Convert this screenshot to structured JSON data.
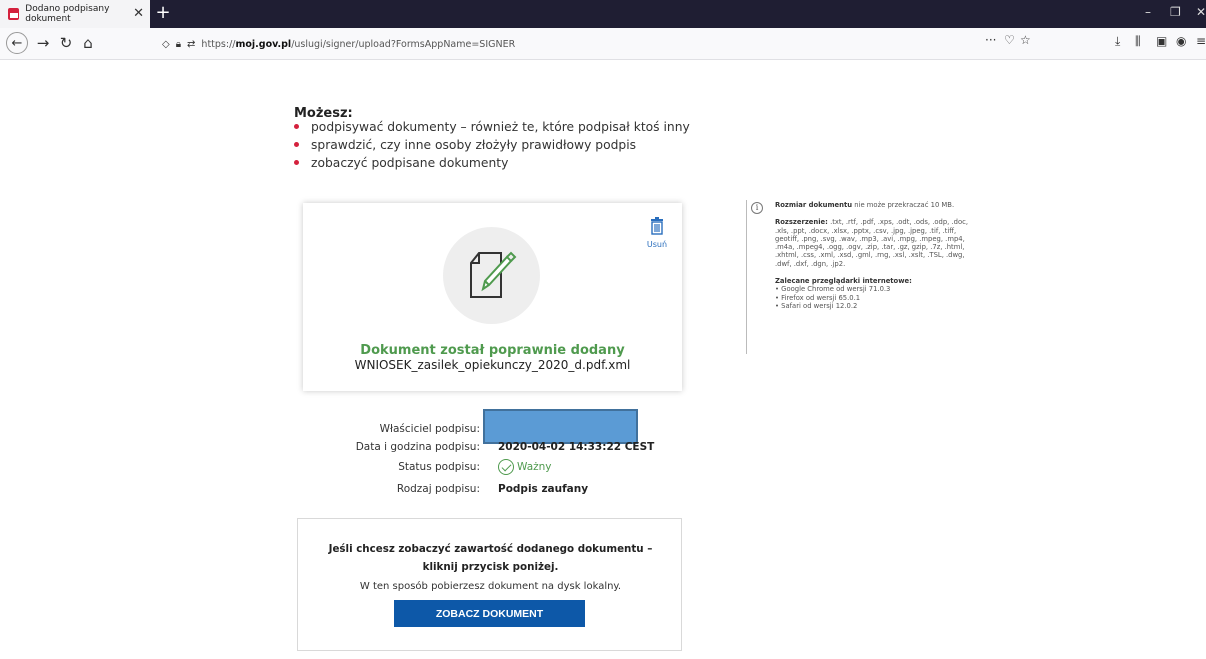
{
  "browser": {
    "tab_title": "Dodano podpisany dokument",
    "tab_close": "✕",
    "new_tab": "+",
    "url_prefix": "https://",
    "url_host": "moj.gov.pl",
    "url_path": "/uslugi/signer/upload?FormsAppName=SIGNER",
    "win_minimize": "–",
    "win_restore": "❐",
    "win_close": "✕"
  },
  "page": {
    "heading": "Możesz:",
    "features": [
      "podpisywać dokumenty – również te, które podpisał ktoś inny",
      "sprawdzić, czy inne osoby złożyły prawidłowy podpis",
      "zobaczyć podpisane dokumenty"
    ],
    "document": {
      "delete_label": "Usuń",
      "status": "Dokument został poprawnie dodany",
      "filename": "WNIOSEK_zasilek_opiekunczy_2020_d.pdf.xml"
    },
    "info": {
      "size_label": "Rozmiar dokumentu",
      "size_text": "nie może przekraczać 10 MB.",
      "ext_label": "Rozszerzenie:",
      "ext_text": ".txt, .rtf, .pdf, .xps, .odt, .ods, .odp, .doc, .xls, .ppt, .docx, .xlsx, .pptx, .csv, .jpg, .jpeg, .tif, .tiff, geotiff, .png, .svg, .wav, .mp3, .avi, .mpg, .mpeg, .mp4, .m4a, .mpeg4, .ogg, .ogv, .zip, .tar, .gz, gzip, .7z, .html, .xhtml, .css, .xml, .xsd, .gml, .rng, .xsl, .xslt, .TSL, .dwg, .dwf, .dxf, .dgn, .jp2.",
      "browsers_label": "Zalecane przeglądarki internetowe:",
      "browsers": [
        "Google Chrome od wersji 71.0.3",
        "Firefox od wersji 65.0.1",
        "Safari od wersji 12.0.2"
      ]
    },
    "signature": {
      "owner_label": "Właściciel podpisu:",
      "date_label": "Data i godzina podpisu:",
      "date_value": "2020-04-02 14:33:22 CEST",
      "status_label": "Status podpisu:",
      "status_value": "Ważny",
      "type_label": "Rodzaj podpisu:",
      "type_value": "Podpis zaufany"
    },
    "view": {
      "title_line1": "Jeśli chcesz zobaczyć zawartość dodanego dokumentu –",
      "title_line2": "kliknij przycisk poniżej.",
      "description": "W ten sposób pobierzesz dokument na dysk lokalny.",
      "button_label": "ZOBACZ DOKUMENT"
    }
  },
  "colors": {
    "accent_red": "#d4213d",
    "success_green": "#4f9a4e",
    "button_blue": "#0d58a8",
    "link_blue": "#2a6ebd",
    "redaction_blue": "#5b9bd5"
  }
}
